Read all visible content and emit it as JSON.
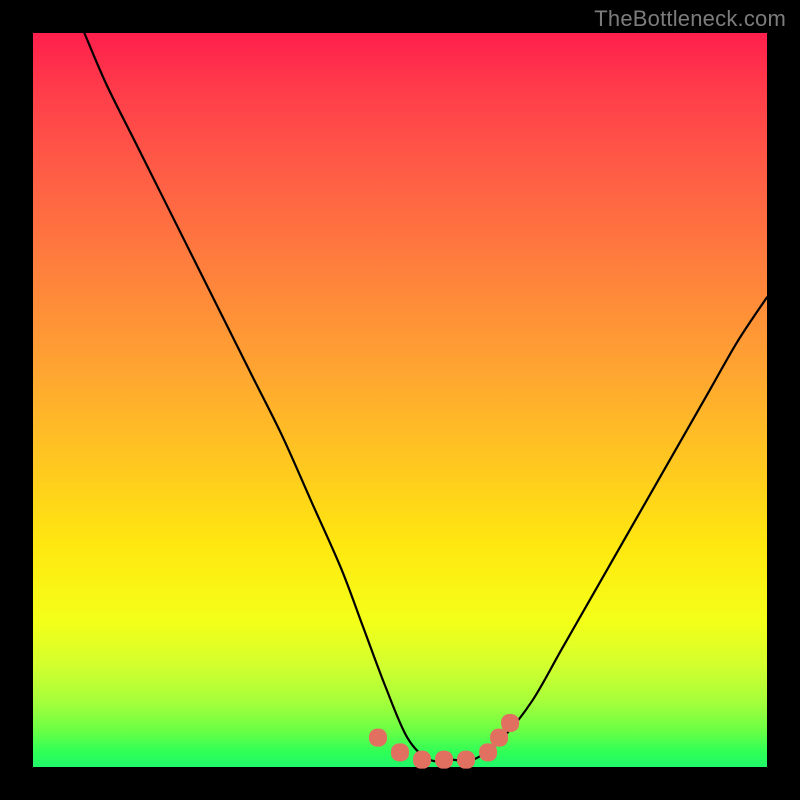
{
  "watermark": "TheBottleneck.com",
  "colors": {
    "curve": "#000000",
    "dots": "#e27060",
    "background_black": "#000000"
  },
  "chart_data": {
    "type": "line",
    "title": "",
    "xlabel": "",
    "ylabel": "",
    "xlim": [
      0,
      100
    ],
    "ylim": [
      0,
      100
    ],
    "grid": false,
    "legend": false,
    "series": [
      {
        "name": "bottleneck-curve",
        "x": [
          7,
          10,
          14,
          18,
          22,
          26,
          30,
          34,
          38,
          42,
          45,
          48,
          51,
          54,
          57,
          60,
          64,
          68,
          72,
          76,
          80,
          84,
          88,
          92,
          96,
          100
        ],
        "y": [
          100,
          93,
          85,
          77,
          69,
          61,
          53,
          45,
          36,
          27,
          19,
          11,
          4,
          1,
          1,
          1,
          4,
          9,
          16,
          23,
          30,
          37,
          44,
          51,
          58,
          64
        ]
      }
    ],
    "markers": [
      {
        "name": "flat-region-dot",
        "x": 47,
        "y": 4
      },
      {
        "name": "flat-region-dot",
        "x": 50,
        "y": 2
      },
      {
        "name": "flat-region-dot",
        "x": 53,
        "y": 1
      },
      {
        "name": "flat-region-dot",
        "x": 56,
        "y": 1
      },
      {
        "name": "flat-region-dot",
        "x": 59,
        "y": 1
      },
      {
        "name": "flat-region-dot",
        "x": 62,
        "y": 2
      },
      {
        "name": "flat-region-dot",
        "x": 63.5,
        "y": 4
      },
      {
        "name": "flat-region-dot",
        "x": 65,
        "y": 6
      }
    ]
  }
}
